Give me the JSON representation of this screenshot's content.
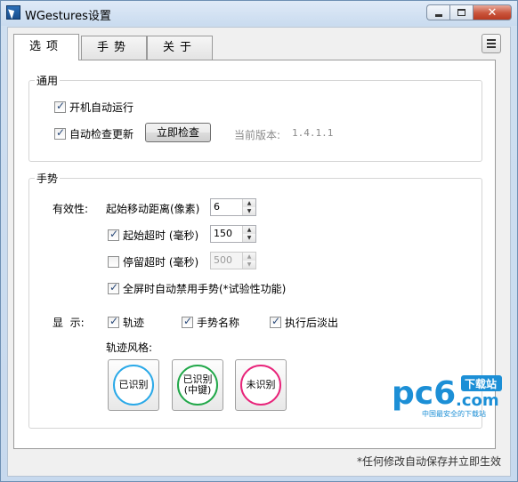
{
  "window": {
    "title": "WGestures设置",
    "close_glyph": "✕"
  },
  "tabs": [
    {
      "label": "选项",
      "active": true
    },
    {
      "label": "手势",
      "active": false
    },
    {
      "label": "关于",
      "active": false
    }
  ],
  "general": {
    "title": "通用",
    "autostart_label": "开机自动运行",
    "autostart_checked": true,
    "autoupdate_label": "自动检查更新",
    "autoupdate_checked": true,
    "check_now_label": "立即检查",
    "version_label": "当前版本:",
    "version_value": "1.4.1.1"
  },
  "gestures": {
    "title": "手势",
    "validity_label": "有效性:",
    "start_distance_label": "起始移动距离(像素)",
    "start_distance_value": "6",
    "start_timeout_label": "起始超时 (毫秒)",
    "start_timeout_value": "150",
    "start_timeout_checked": true,
    "stay_timeout_label": "停留超时 (毫秒)",
    "stay_timeout_value": "500",
    "stay_timeout_checked": false,
    "fullscreen_label": "全屏时自动禁用手势(*试验性功能)",
    "fullscreen_checked": true,
    "display_label": "显  示:",
    "trail_label": "轨迹",
    "trail_checked": true,
    "gesture_name_label": "手势名称",
    "gesture_name_checked": true,
    "fade_label": "执行后淡出",
    "fade_checked": true,
    "trail_style_label": "轨迹风格:",
    "styles": [
      {
        "label": "已识别",
        "color": "#2aa9e8"
      },
      {
        "label": "已识别(中键)",
        "line1": "已识别",
        "line2": "(中键)",
        "color": "#22a84a"
      },
      {
        "label": "未识别",
        "color": "#e8247a"
      }
    ]
  },
  "watermark": {
    "brand": "pc6",
    "badge": "下载站",
    "domain": ".com",
    "tagline": "中国最安全的下载站",
    "brand_color": "#1c8fd6",
    "badge_color": "#1c8fd6"
  },
  "footer_note": "*任何修改自动保存并立即生效"
}
